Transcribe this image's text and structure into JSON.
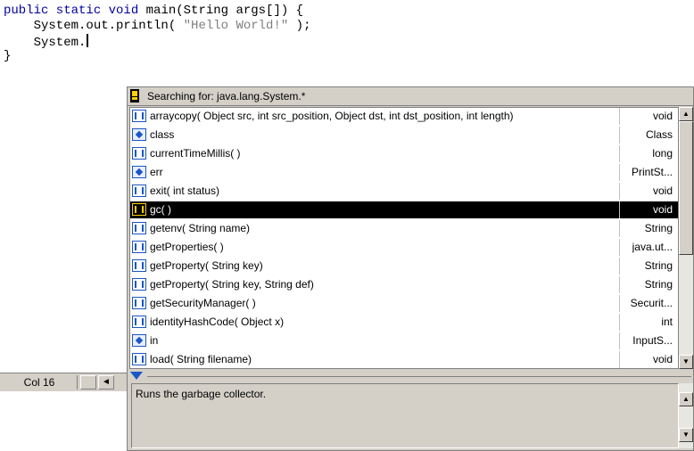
{
  "editor": {
    "line1": {
      "kw": "public static void",
      "rest": " main(String args[]) {"
    },
    "line2": {
      "prefix": "    System.out.println( ",
      "string": "\"Hello World!\"",
      "suffix": " );"
    },
    "line3": "    System.",
    "line4": "}"
  },
  "statusbar": {
    "column": "Col 16",
    "nav_left": "◄"
  },
  "completion": {
    "search_label": "Searching for: java.lang.System.*",
    "items": [
      {
        "kind": "method",
        "label": "arraycopy( Object src, int src_position, Object dst, int dst_position, int length)",
        "type": "void"
      },
      {
        "kind": "field",
        "label": "class",
        "type": "Class"
      },
      {
        "kind": "method",
        "label": "currentTimeMillis( )",
        "type": "long"
      },
      {
        "kind": "field",
        "label": "err",
        "type": "PrintSt..."
      },
      {
        "kind": "method",
        "label": "exit( int status)",
        "type": "void"
      },
      {
        "kind": "method",
        "label": "gc( )",
        "type": "void",
        "selected": true
      },
      {
        "kind": "method",
        "label": "getenv( String name)",
        "type": "String"
      },
      {
        "kind": "method",
        "label": "getProperties( )",
        "type": "java.ut..."
      },
      {
        "kind": "method",
        "label": "getProperty( String key)",
        "type": "String"
      },
      {
        "kind": "method",
        "label": "getProperty( String key, String def)",
        "type": "String"
      },
      {
        "kind": "method",
        "label": "getSecurityManager( )",
        "type": "Securit..."
      },
      {
        "kind": "method",
        "label": "identityHashCode( Object x)",
        "type": "int"
      },
      {
        "kind": "field",
        "label": "in",
        "type": "InputS..."
      },
      {
        "kind": "method",
        "label": "load( String filename)",
        "type": "void"
      }
    ],
    "description": "Runs the garbage collector."
  },
  "colors": {
    "selection_bg": "#000000",
    "keyword": "#0000a0",
    "string": "#808080",
    "icon": "#1a56c4"
  }
}
